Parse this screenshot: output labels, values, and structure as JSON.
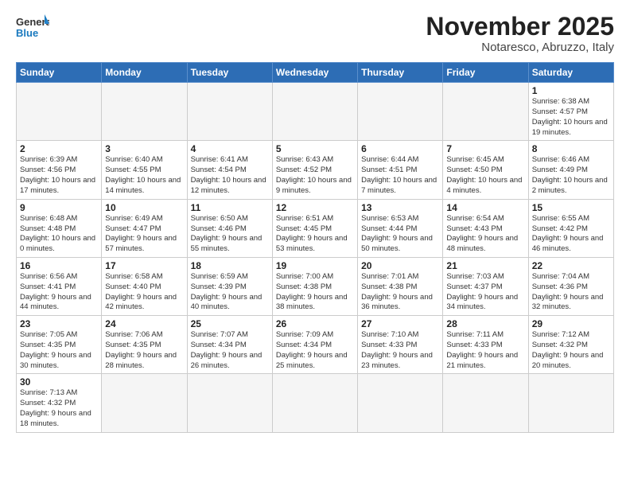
{
  "logo": {
    "line1": "General",
    "line2": "Blue"
  },
  "title": "November 2025",
  "subtitle": "Notaresco, Abruzzo, Italy",
  "weekdays": [
    "Sunday",
    "Monday",
    "Tuesday",
    "Wednesday",
    "Thursday",
    "Friday",
    "Saturday"
  ],
  "weeks": [
    [
      {
        "day": "",
        "info": ""
      },
      {
        "day": "",
        "info": ""
      },
      {
        "day": "",
        "info": ""
      },
      {
        "day": "",
        "info": ""
      },
      {
        "day": "",
        "info": ""
      },
      {
        "day": "",
        "info": ""
      },
      {
        "day": "1",
        "info": "Sunrise: 6:38 AM\nSunset: 4:57 PM\nDaylight: 10 hours and 19 minutes."
      }
    ],
    [
      {
        "day": "2",
        "info": "Sunrise: 6:39 AM\nSunset: 4:56 PM\nDaylight: 10 hours and 17 minutes."
      },
      {
        "day": "3",
        "info": "Sunrise: 6:40 AM\nSunset: 4:55 PM\nDaylight: 10 hours and 14 minutes."
      },
      {
        "day": "4",
        "info": "Sunrise: 6:41 AM\nSunset: 4:54 PM\nDaylight: 10 hours and 12 minutes."
      },
      {
        "day": "5",
        "info": "Sunrise: 6:43 AM\nSunset: 4:52 PM\nDaylight: 10 hours and 9 minutes."
      },
      {
        "day": "6",
        "info": "Sunrise: 6:44 AM\nSunset: 4:51 PM\nDaylight: 10 hours and 7 minutes."
      },
      {
        "day": "7",
        "info": "Sunrise: 6:45 AM\nSunset: 4:50 PM\nDaylight: 10 hours and 4 minutes."
      },
      {
        "day": "8",
        "info": "Sunrise: 6:46 AM\nSunset: 4:49 PM\nDaylight: 10 hours and 2 minutes."
      }
    ],
    [
      {
        "day": "9",
        "info": "Sunrise: 6:48 AM\nSunset: 4:48 PM\nDaylight: 10 hours and 0 minutes."
      },
      {
        "day": "10",
        "info": "Sunrise: 6:49 AM\nSunset: 4:47 PM\nDaylight: 9 hours and 57 minutes."
      },
      {
        "day": "11",
        "info": "Sunrise: 6:50 AM\nSunset: 4:46 PM\nDaylight: 9 hours and 55 minutes."
      },
      {
        "day": "12",
        "info": "Sunrise: 6:51 AM\nSunset: 4:45 PM\nDaylight: 9 hours and 53 minutes."
      },
      {
        "day": "13",
        "info": "Sunrise: 6:53 AM\nSunset: 4:44 PM\nDaylight: 9 hours and 50 minutes."
      },
      {
        "day": "14",
        "info": "Sunrise: 6:54 AM\nSunset: 4:43 PM\nDaylight: 9 hours and 48 minutes."
      },
      {
        "day": "15",
        "info": "Sunrise: 6:55 AM\nSunset: 4:42 PM\nDaylight: 9 hours and 46 minutes."
      }
    ],
    [
      {
        "day": "16",
        "info": "Sunrise: 6:56 AM\nSunset: 4:41 PM\nDaylight: 9 hours and 44 minutes."
      },
      {
        "day": "17",
        "info": "Sunrise: 6:58 AM\nSunset: 4:40 PM\nDaylight: 9 hours and 42 minutes."
      },
      {
        "day": "18",
        "info": "Sunrise: 6:59 AM\nSunset: 4:39 PM\nDaylight: 9 hours and 40 minutes."
      },
      {
        "day": "19",
        "info": "Sunrise: 7:00 AM\nSunset: 4:38 PM\nDaylight: 9 hours and 38 minutes."
      },
      {
        "day": "20",
        "info": "Sunrise: 7:01 AM\nSunset: 4:38 PM\nDaylight: 9 hours and 36 minutes."
      },
      {
        "day": "21",
        "info": "Sunrise: 7:03 AM\nSunset: 4:37 PM\nDaylight: 9 hours and 34 minutes."
      },
      {
        "day": "22",
        "info": "Sunrise: 7:04 AM\nSunset: 4:36 PM\nDaylight: 9 hours and 32 minutes."
      }
    ],
    [
      {
        "day": "23",
        "info": "Sunrise: 7:05 AM\nSunset: 4:35 PM\nDaylight: 9 hours and 30 minutes."
      },
      {
        "day": "24",
        "info": "Sunrise: 7:06 AM\nSunset: 4:35 PM\nDaylight: 9 hours and 28 minutes."
      },
      {
        "day": "25",
        "info": "Sunrise: 7:07 AM\nSunset: 4:34 PM\nDaylight: 9 hours and 26 minutes."
      },
      {
        "day": "26",
        "info": "Sunrise: 7:09 AM\nSunset: 4:34 PM\nDaylight: 9 hours and 25 minutes."
      },
      {
        "day": "27",
        "info": "Sunrise: 7:10 AM\nSunset: 4:33 PM\nDaylight: 9 hours and 23 minutes."
      },
      {
        "day": "28",
        "info": "Sunrise: 7:11 AM\nSunset: 4:33 PM\nDaylight: 9 hours and 21 minutes."
      },
      {
        "day": "29",
        "info": "Sunrise: 7:12 AM\nSunset: 4:32 PM\nDaylight: 9 hours and 20 minutes."
      }
    ],
    [
      {
        "day": "30",
        "info": "Sunrise: 7:13 AM\nSunset: 4:32 PM\nDaylight: 9 hours and 18 minutes."
      },
      {
        "day": "",
        "info": ""
      },
      {
        "day": "",
        "info": ""
      },
      {
        "day": "",
        "info": ""
      },
      {
        "day": "",
        "info": ""
      },
      {
        "day": "",
        "info": ""
      },
      {
        "day": "",
        "info": ""
      }
    ]
  ]
}
